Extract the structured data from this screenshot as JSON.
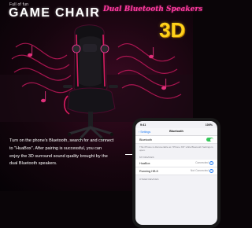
{
  "banner": {
    "tagline": "Full of fun",
    "title": "GAME CHAIR",
    "subtitle": "Dual Bluetooth Speakers",
    "badge": "3D"
  },
  "caption": {
    "lines": [
      "Turn on the phone's Bluetooth, search for and connect",
      "to \"HuaBox\". After pairing is successful, you can",
      "enjoy the 3D surround sound quality brought by the",
      "dual Bluetooth speakers."
    ]
  },
  "phone": {
    "status_time": "9:41",
    "status_right": "100%",
    "back_label": "Settings",
    "nav_title": "Bluetooth",
    "bluetooth_label": "Bluetooth",
    "bluetooth_on": true,
    "bluetooth_note": "This iPhone is discoverable as \"iPhone XR\" while Bluetooth Settings is open.",
    "section_my_devices": "MY DEVICES",
    "devices": [
      {
        "name": "HuaBox",
        "status": "Connected"
      },
      {
        "name": "Running HB 8",
        "status": "Not Connected"
      }
    ],
    "section_other_devices": "OTHER DEVICES"
  },
  "colors": {
    "accent_pink": "#ff3aa0",
    "badge_yellow": "#ffd21a",
    "ios_blue": "#1f7cf5",
    "toggle_green": "#34c759"
  }
}
